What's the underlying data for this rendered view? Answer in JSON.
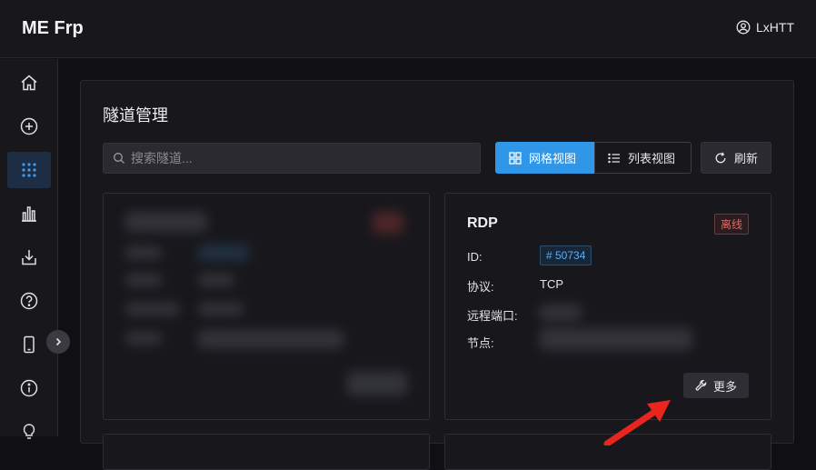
{
  "header": {
    "app_title": "ME Frp",
    "username": "LxHTT"
  },
  "sidebar": {
    "items": [
      {
        "icon": "home-icon"
      },
      {
        "icon": "plus-circle-icon"
      },
      {
        "icon": "grid-dots-icon",
        "active": true
      },
      {
        "icon": "bar-chart-icon"
      },
      {
        "icon": "download-icon"
      },
      {
        "icon": "help-circle-icon"
      },
      {
        "icon": "mobile-icon"
      },
      {
        "icon": "info-icon"
      },
      {
        "icon": "lightbulb-icon"
      }
    ]
  },
  "panel": {
    "title": "隧道管理",
    "search_placeholder": "搜索隧道...",
    "grid_view_label": "网格视图",
    "list_view_label": "列表视图",
    "refresh_label": "刷新"
  },
  "tunnel_card": {
    "name": "RDP",
    "status": "离线",
    "id_label": "ID:",
    "id_value": "# 50734",
    "protocol_label": "协议:",
    "protocol_value": "TCP",
    "remote_port_label": "远程端口:",
    "node_label": "节点:",
    "more_label": "更多"
  },
  "colors": {
    "accent": "#2f96e8",
    "offline": "#e06a6a",
    "annotation_arrow": "#e8261e"
  }
}
